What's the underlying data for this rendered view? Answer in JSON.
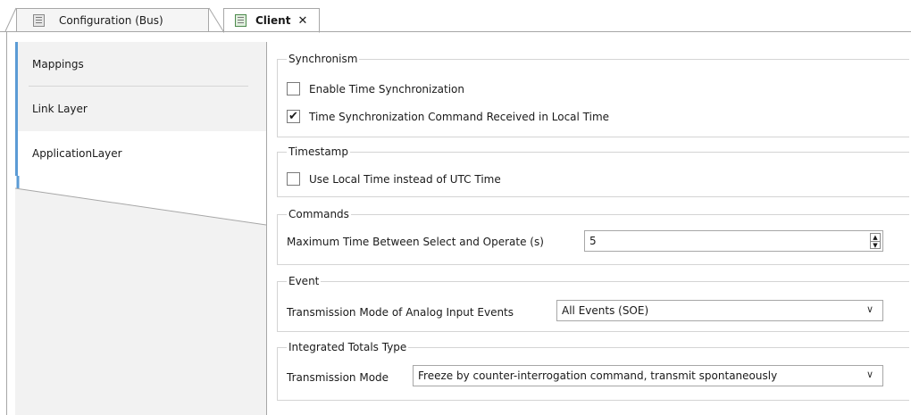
{
  "tabs": [
    {
      "label": "Configuration (Bus)",
      "icon": "bus-config-icon"
    },
    {
      "label": "Client",
      "icon": "client-device-icon",
      "close": "✕"
    }
  ],
  "nav": {
    "items": [
      {
        "label": "Mappings"
      },
      {
        "label": "Link Layer"
      },
      {
        "label": "ApplicationLayer"
      }
    ],
    "accent": "#5b9bd5"
  },
  "synchronism": {
    "legend": "Synchronism",
    "enable_time_sync": {
      "label": "Enable Time Synchronization",
      "checked": false
    },
    "local_time_cmd": {
      "label": "Time Synchronization Command Received in Local Time",
      "checked": true
    }
  },
  "timestamp": {
    "legend": "Timestamp",
    "use_local_time": {
      "label": "Use Local Time instead of UTC Time",
      "checked": false
    }
  },
  "commands": {
    "legend": "Commands",
    "max_time_label": "Maximum Time Between Select and Operate (s)",
    "max_time_value": "5"
  },
  "event": {
    "legend": "Event",
    "mode_label": "Transmission Mode of Analog Input Events",
    "mode_value": "All Events (SOE)"
  },
  "integrated_totals": {
    "legend": "Integrated Totals Type",
    "mode_label": "Transmission Mode",
    "mode_value": "Freeze by counter-interrogation command, transmit spontaneously"
  }
}
